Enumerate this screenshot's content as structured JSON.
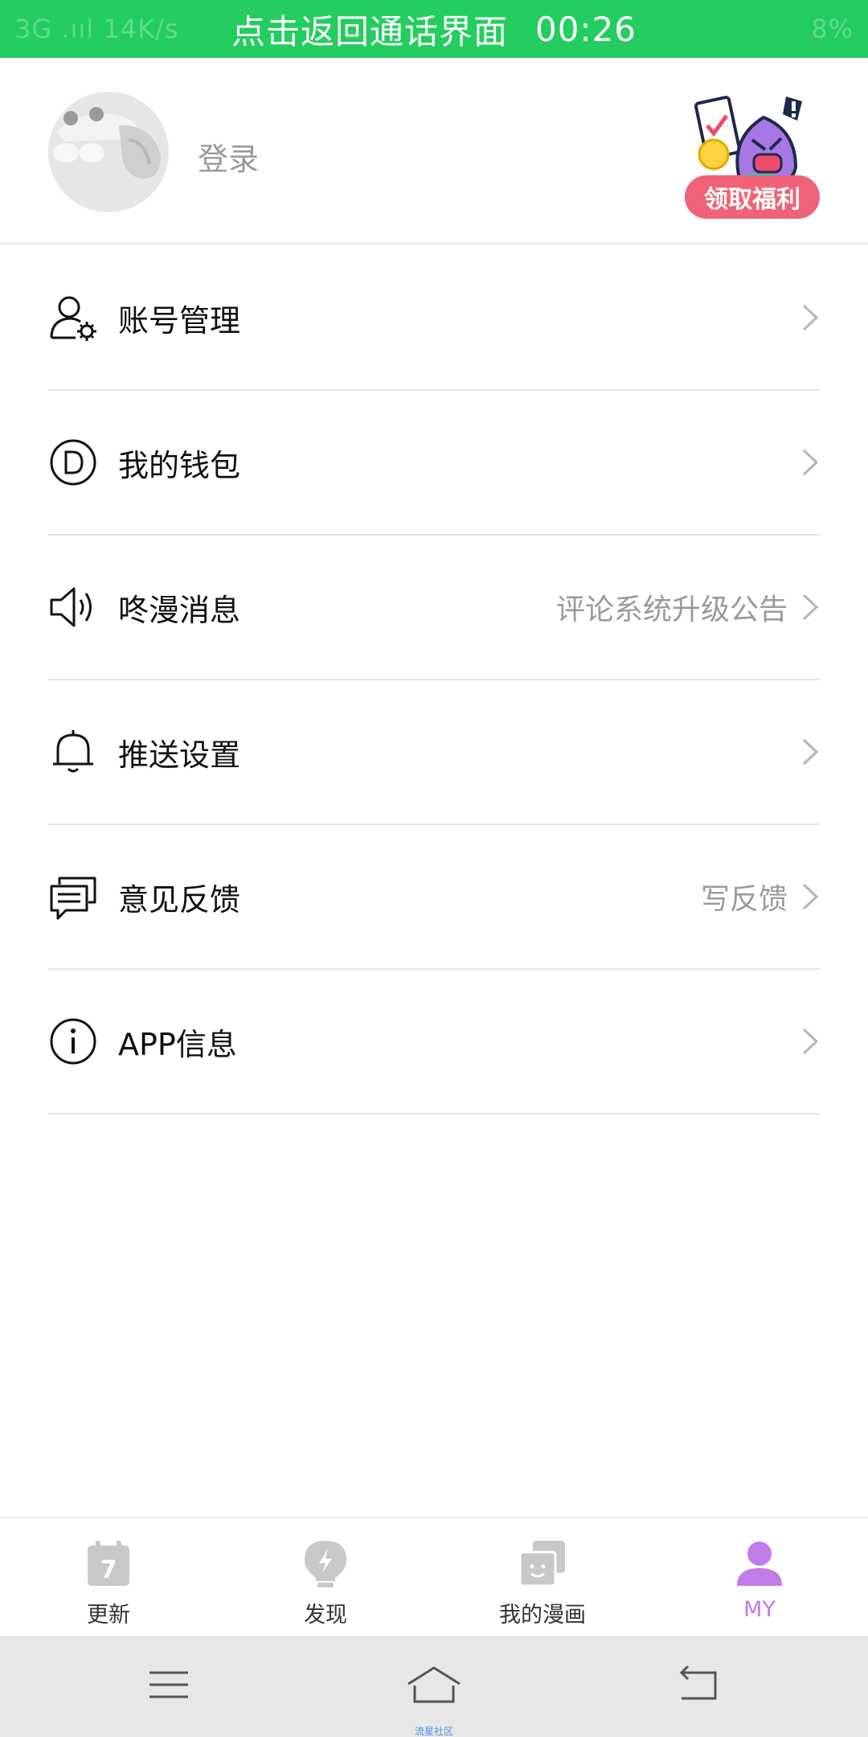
{
  "status_bar": {
    "left_faded": "3G .ııl 14K/s",
    "right_faded": "8%",
    "call_text": "点击返回通话界面",
    "call_timer": "00:26"
  },
  "profile": {
    "login_label": "登录",
    "welfare_label": "领取福利"
  },
  "menu": {
    "items": [
      {
        "icon": "account-settings-icon",
        "label": "账号管理",
        "hint": ""
      },
      {
        "icon": "wallet-icon",
        "label": "我的钱包",
        "hint": ""
      },
      {
        "icon": "speaker-icon",
        "label": "咚漫消息",
        "hint": "评论系统升级公告"
      },
      {
        "icon": "bell-icon",
        "label": "推送设置",
        "hint": ""
      },
      {
        "icon": "feedback-icon",
        "label": "意见反馈",
        "hint": "写反馈"
      },
      {
        "icon": "info-icon",
        "label": "APP信息",
        "hint": ""
      }
    ]
  },
  "tabbar": {
    "tabs": [
      {
        "label": "更新",
        "icon": "calendar-icon",
        "badge": "7",
        "active": false
      },
      {
        "label": "发现",
        "icon": "lightbulb-icon",
        "active": false
      },
      {
        "label": "我的漫画",
        "icon": "comics-icon",
        "active": false
      },
      {
        "label": "MY",
        "icon": "person-icon",
        "active": true
      }
    ]
  },
  "navbar": {
    "caption": "流星社区"
  },
  "colors": {
    "call_banner": "#23cd5f",
    "welfare_button": "#ef6277",
    "active_tab": "#c07ce9",
    "inactive_icon": "#c8c8c8"
  }
}
